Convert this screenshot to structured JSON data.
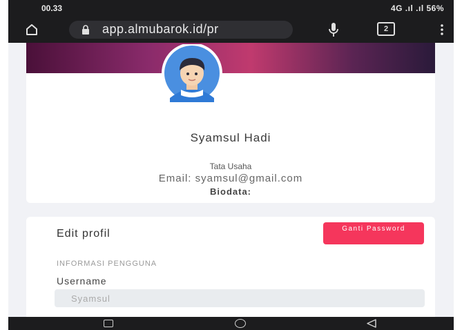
{
  "status_bar": {
    "time": "00.33",
    "indicators": "4G .ıl .ıl 56%"
  },
  "browser": {
    "url": "app.almubarok.id/pr",
    "tabs_count": "2"
  },
  "profile": {
    "name": "Syamsul Hadi",
    "role": "Tata Usaha",
    "email": "Email: syamsul@gmail.com",
    "biodata_label": "Biodata:"
  },
  "edit": {
    "title": "Edit profil",
    "password_button": "Ganti Password",
    "section_label": "INFORMASI PENGGUNA",
    "username_label": "Username",
    "username_value": "Syamsul"
  },
  "colors": {
    "accent": "#f5365c",
    "page_bg": "#f1f2f6",
    "chrome_bg": "#1c1c1e"
  },
  "icons": [
    "home-icon",
    "lock-icon",
    "mic-icon",
    "tabs-icon",
    "menu-icon",
    "avatar-icon",
    "nav-recent-icon",
    "nav-home-icon",
    "nav-back-icon"
  ]
}
